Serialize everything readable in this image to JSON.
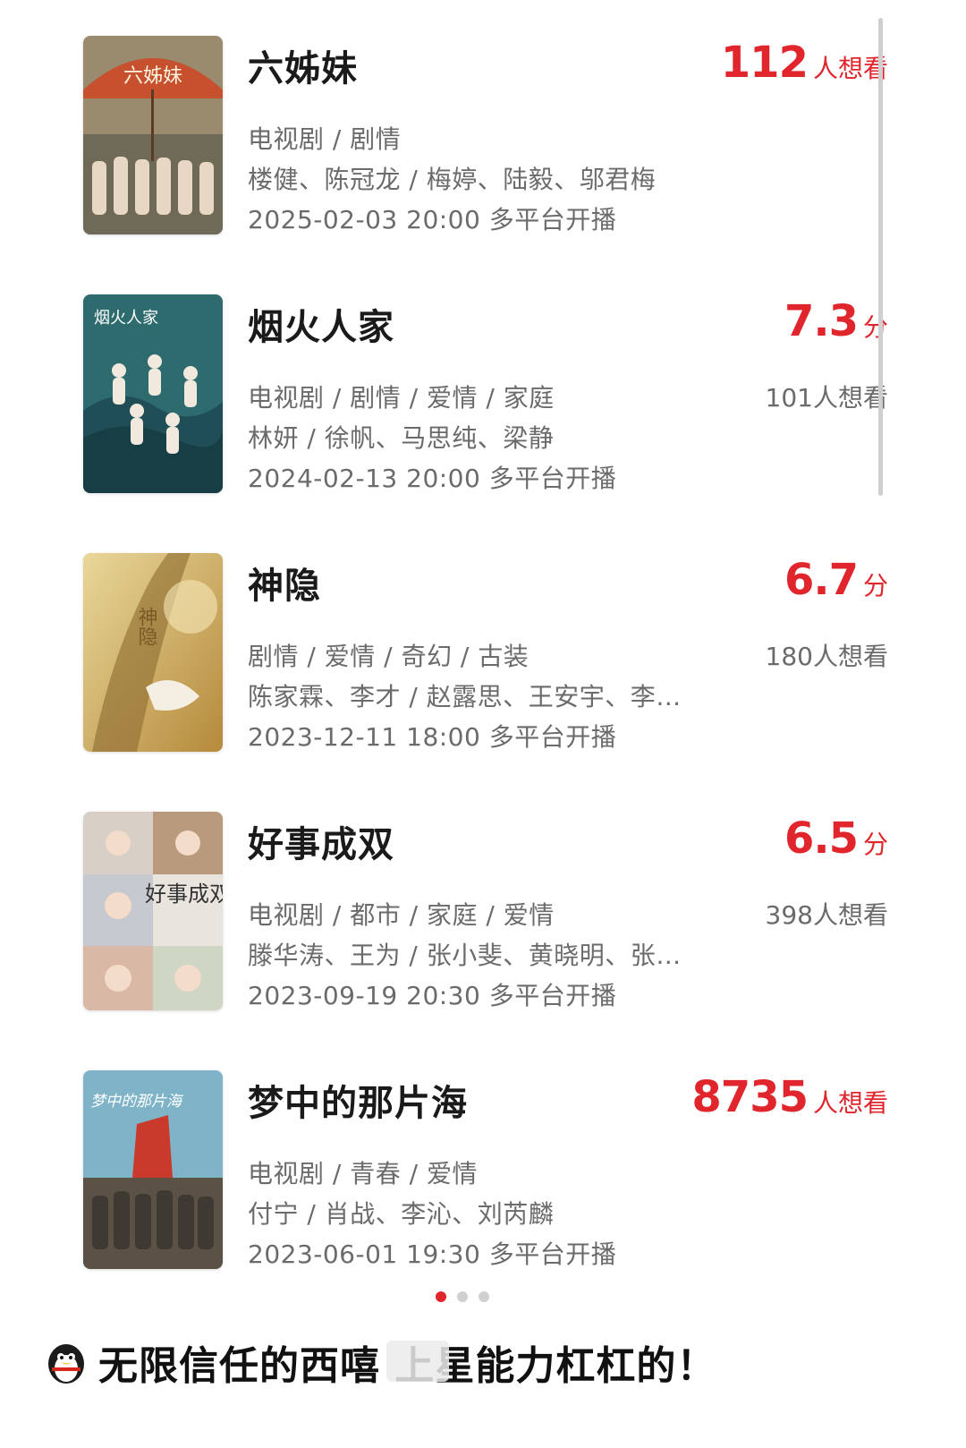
{
  "list": {
    "items": [
      {
        "title": "六姊妹",
        "score_big": "112",
        "score_unit": "人想看",
        "want": "",
        "genre": "电视剧 / 剧情",
        "cast": "楼健、陈冠龙 / 梅婷、陆毅、邬君梅",
        "date": "2025-02-03 20:00 多平台开播",
        "poster_text": "六姊妹"
      },
      {
        "title": "烟火人家",
        "score_big": "7.3",
        "score_unit": "分",
        "want": "101人想看",
        "genre": "电视剧 / 剧情 / 爱情 / 家庭",
        "cast": "林妍 / 徐帆、马思纯、梁静",
        "date": "2024-02-13 20:00 多平台开播",
        "poster_text": "烟火人家"
      },
      {
        "title": "神隐",
        "score_big": "6.7",
        "score_unit": "分",
        "want": "180人想看",
        "genre": "剧情 / 爱情 / 奇幻 / 古装",
        "cast": "陈家霖、李才 / 赵露思、王安宇、李…",
        "date": "2023-12-11 18:00 多平台开播",
        "poster_text": "神隐"
      },
      {
        "title": "好事成双",
        "score_big": "6.5",
        "score_unit": "分",
        "want": "398人想看",
        "genre": "电视剧 / 都市 / 家庭 / 爱情",
        "cast": "滕华涛、王为 / 张小斐、黄晓明、张…",
        "date": "2023-09-19 20:30 多平台开播",
        "poster_text": "好事成双"
      },
      {
        "title": "梦中的那片海",
        "score_big": "8735",
        "score_unit": "人想看",
        "want": "",
        "genre": "电视剧 / 青春 / 爱情",
        "cast": "付宁 / 肖战、李沁、刘芮麟",
        "date": "2023-06-01 19:30 多平台开播",
        "poster_text": "梦中的那片海"
      }
    ]
  },
  "pager": {
    "total": 3,
    "active": 0
  },
  "footer": {
    "text": "无限信任的西嘻 上星能力杠杠的！"
  },
  "colors": {
    "accent": "#e0262c",
    "meta": "#6b6b6b"
  },
  "icons": {
    "footer_avatar": "penguin-icon"
  }
}
